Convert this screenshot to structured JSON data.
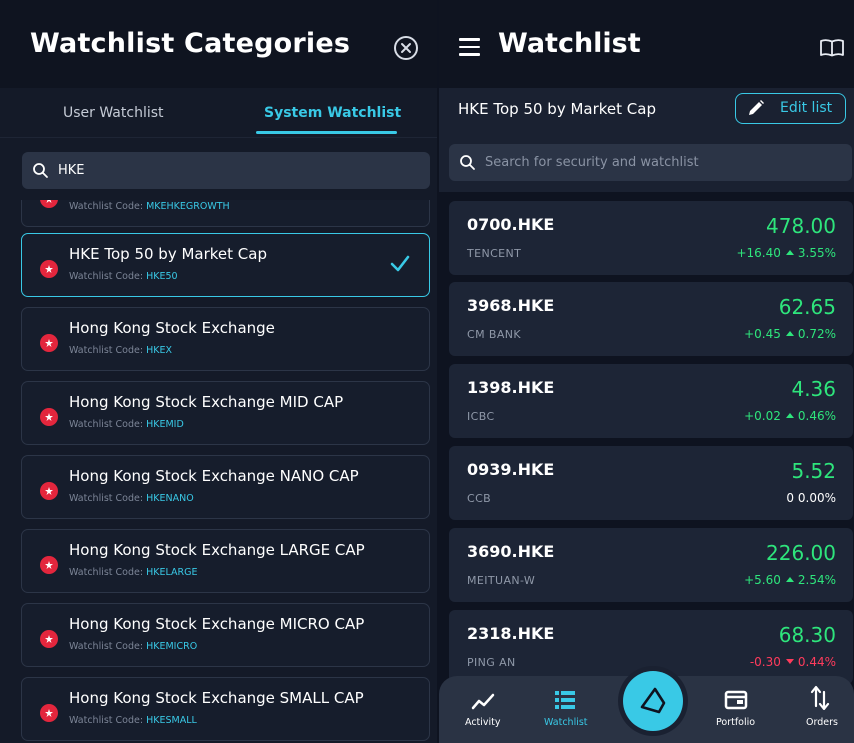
{
  "left_panel": {
    "title": "Watchlist Categories",
    "tabs": [
      {
        "label": "User Watchlist",
        "active": false
      },
      {
        "label": "System Watchlist",
        "active": true
      }
    ],
    "search": {
      "value": "HKE"
    },
    "code_prefix": "Watchlist Code:",
    "items": [
      {
        "name": "",
        "code": "MKEHKEGROWTH",
        "selected": false
      },
      {
        "name": "HKE Top 50 by Market Cap",
        "code": "HKE50",
        "selected": true
      },
      {
        "name": "Hong Kong Stock Exchange",
        "code": "HKEX",
        "selected": false
      },
      {
        "name": "Hong Kong Stock Exchange MID CAP",
        "code": "HKEMID",
        "selected": false
      },
      {
        "name": "Hong Kong Stock Exchange NANO CAP",
        "code": "HKENANO",
        "selected": false
      },
      {
        "name": "Hong Kong Stock Exchange LARGE CAP",
        "code": "HKELARGE",
        "selected": false
      },
      {
        "name": "Hong Kong Stock Exchange MICRO CAP",
        "code": "HKEMICRO",
        "selected": false
      },
      {
        "name": "Hong Kong Stock Exchange SMALL CAP",
        "code": "HKESMALL",
        "selected": false
      }
    ]
  },
  "right_panel": {
    "title": "Watchlist",
    "watchlist_name": "HKE Top 50 by Market Cap",
    "edit_label": "Edit list",
    "search_placeholder": "Search for security and watchlist",
    "securities": [
      {
        "ticker": "0700.HKE",
        "name": "TENCENT",
        "price": "478.00",
        "change": "+16.40",
        "pct": "3.55%",
        "direction": "up"
      },
      {
        "ticker": "3968.HKE",
        "name": "CM BANK",
        "price": "62.65",
        "change": "+0.45",
        "pct": "0.72%",
        "direction": "up"
      },
      {
        "ticker": "1398.HKE",
        "name": "ICBC",
        "price": "4.36",
        "change": "+0.02",
        "pct": "0.46%",
        "direction": "up"
      },
      {
        "ticker": "0939.HKE",
        "name": "CCB",
        "price": "5.52",
        "change": "0",
        "pct": "0.00%",
        "direction": "flat"
      },
      {
        "ticker": "3690.HKE",
        "name": "MEITUAN-W",
        "price": "226.00",
        "change": "+5.60",
        "pct": "2.54%",
        "direction": "up"
      },
      {
        "ticker": "2318.HKE",
        "name": "PING AN",
        "price": "68.30",
        "change": "-0.30",
        "pct": "0.44%",
        "direction": "down"
      }
    ],
    "nav": [
      {
        "label": "Activity",
        "icon": "activity-chart-icon",
        "active": false
      },
      {
        "label": "Watchlist",
        "icon": "watchlist-icon",
        "active": true
      },
      {
        "label": "",
        "icon": "center-logo-icon",
        "active": false
      },
      {
        "label": "Portfolio",
        "icon": "portfolio-icon",
        "active": false
      },
      {
        "label": "Orders",
        "icon": "orders-arrows-icon",
        "active": false
      }
    ]
  },
  "colors": {
    "accent": "#39c9e6",
    "up": "#2ee57c",
    "down": "#ff3b5c",
    "flag": "#e3263d"
  }
}
